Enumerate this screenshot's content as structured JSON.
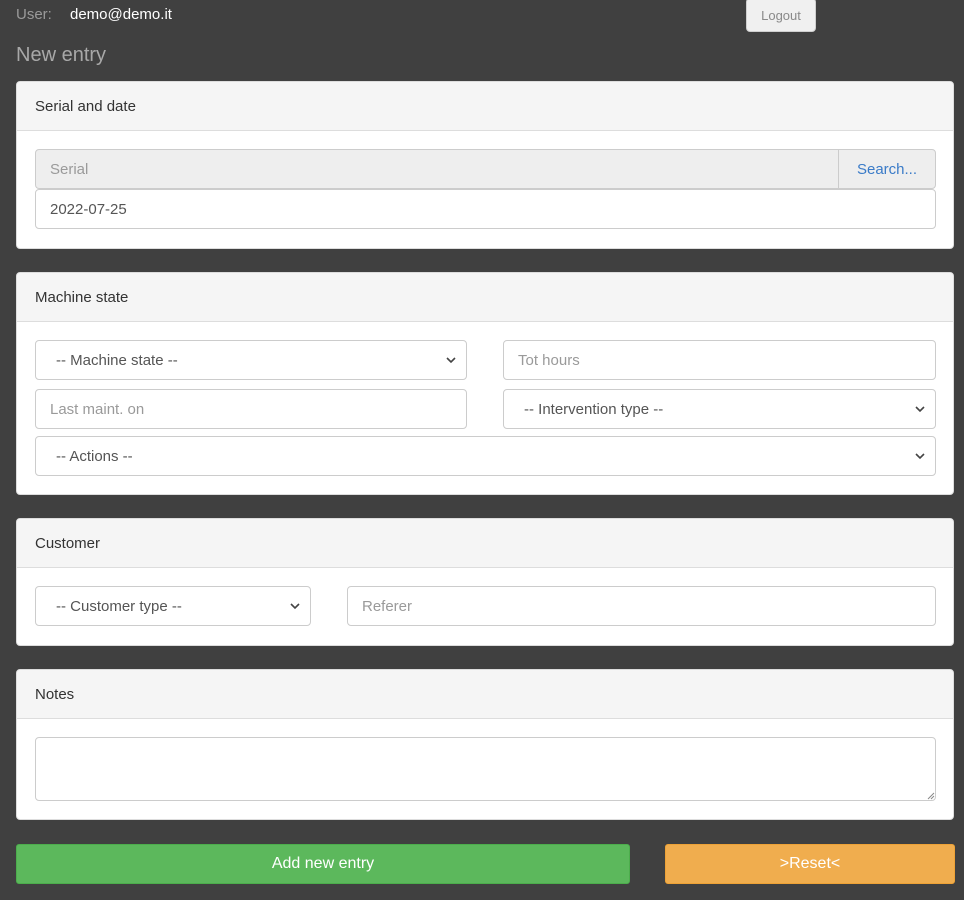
{
  "header": {
    "user_label": "User:",
    "user_email": "demo@demo.it",
    "logout_label": "Logout"
  },
  "page_title": "New entry",
  "serial_panel": {
    "title": "Serial and date",
    "serial_placeholder": "Serial",
    "search_label": "Search...",
    "date_value": "2022-07-25"
  },
  "machine_panel": {
    "title": "Machine state",
    "machine_state_selected": "-- Machine state --",
    "tot_hours_placeholder": "Tot hours",
    "last_maint_placeholder": "Last maint. on",
    "intervention_type_selected": "-- Intervention type --",
    "actions_selected": "-- Actions --"
  },
  "customer_panel": {
    "title": "Customer",
    "customer_type_selected": "-- Customer type --",
    "referer_placeholder": "Referer"
  },
  "notes_panel": {
    "title": "Notes",
    "notes_value": ""
  },
  "buttons": {
    "add_label": "Add new entry",
    "reset_label": ">Reset<"
  },
  "colors": {
    "background": "#404040",
    "add_button": "#5cb85c",
    "reset_button": "#f0ad4e",
    "link": "#3a7bc8"
  }
}
